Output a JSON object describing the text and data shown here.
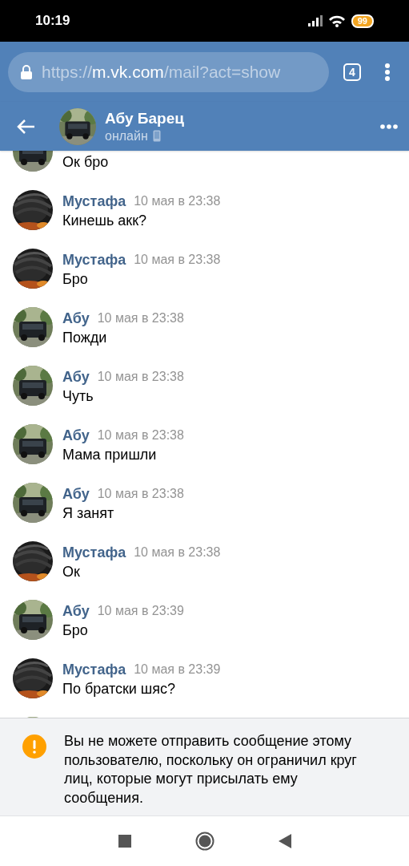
{
  "status_bar": {
    "time": "10:19",
    "battery": "99"
  },
  "browser": {
    "url": {
      "scheme": "https://",
      "host": "m.vk.com",
      "path": "/mail?act=show"
    },
    "tab_count": "4"
  },
  "header": {
    "name": "Абу Барец",
    "status": "онлайн"
  },
  "messages": [
    {
      "own": false,
      "text": "Ок бро"
    },
    {
      "own": true,
      "sender": "Мустафа",
      "time": "10 мая в 23:38",
      "text": "Кинешь акк?"
    },
    {
      "own": true,
      "sender": "Мустафа",
      "time": "10 мая в 23:38",
      "text": "Бро"
    },
    {
      "own": false,
      "sender": "Абу",
      "time": "10 мая в 23:38",
      "text": "Пожди"
    },
    {
      "own": false,
      "sender": "Абу",
      "time": "10 мая в 23:38",
      "text": "Чуть"
    },
    {
      "own": false,
      "sender": "Абу",
      "time": "10 мая в 23:38",
      "text": "Мама пришли"
    },
    {
      "own": false,
      "sender": "Абу",
      "time": "10 мая в 23:38",
      "text": "Я занят"
    },
    {
      "own": true,
      "sender": "Мустафа",
      "time": "10 мая в 23:38",
      "text": "Ок"
    },
    {
      "own": false,
      "sender": "Абу",
      "time": "10 мая в 23:39",
      "text": "Бро"
    },
    {
      "own": true,
      "sender": "Мустафа",
      "time": "10 мая в 23:39",
      "text": "По братски шяс?"
    },
    {
      "own": false
    }
  ],
  "notice": {
    "text": "Вы не можете отправить сообщение этому пользователю, поскольку он ограничил круг лиц, которые могут присылать ему сообщения."
  }
}
